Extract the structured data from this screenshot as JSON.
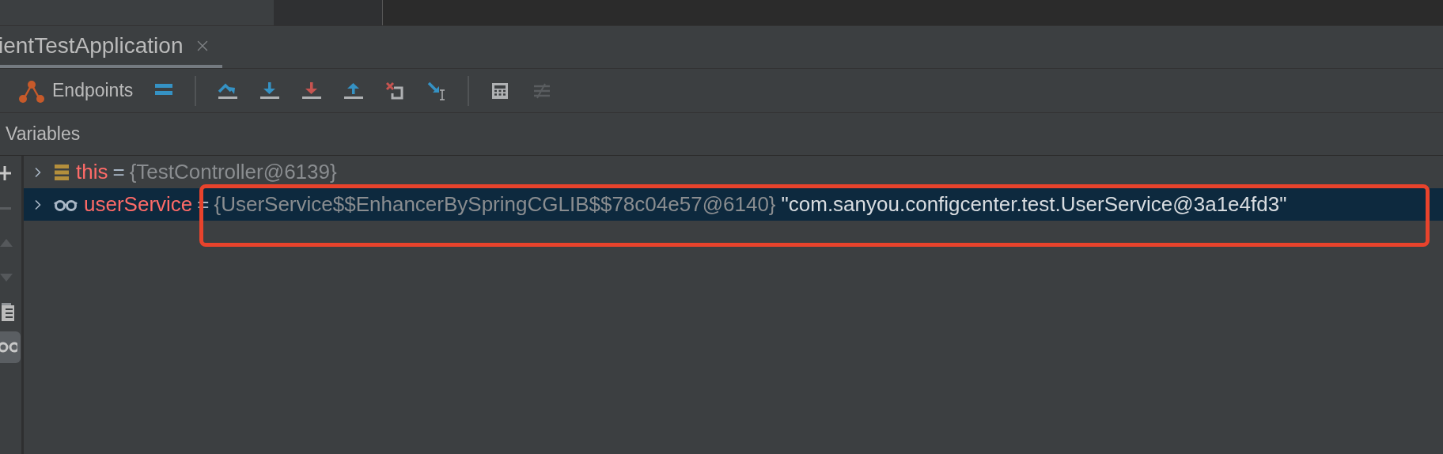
{
  "tab": {
    "title": "ientTestApplication",
    "selected": true
  },
  "toolbar": {
    "endpoints_label": "Endpoints"
  },
  "panel": {
    "title": "Variables"
  },
  "variables": [
    {
      "kind": "object",
      "name": "this",
      "equals": "=",
      "value": "{TestController@6139}",
      "selected": false,
      "expanded": false
    },
    {
      "kind": "watch",
      "name": "userService",
      "equals": "=",
      "value": "{UserService$$EnhancerBySpringCGLIB$$78c04e57@6140}",
      "string": "\"com.sanyou.configcenter.test.UserService@3a1e4fd3\"",
      "selected": true,
      "expanded": false
    }
  ],
  "side_tools": [
    {
      "kind": "add",
      "selected": false
    },
    {
      "kind": "remove",
      "selected": false
    },
    {
      "kind": "up",
      "selected": false
    },
    {
      "kind": "down",
      "selected": false
    },
    {
      "kind": "copy",
      "selected": false
    },
    {
      "kind": "watch",
      "selected": true
    }
  ]
}
